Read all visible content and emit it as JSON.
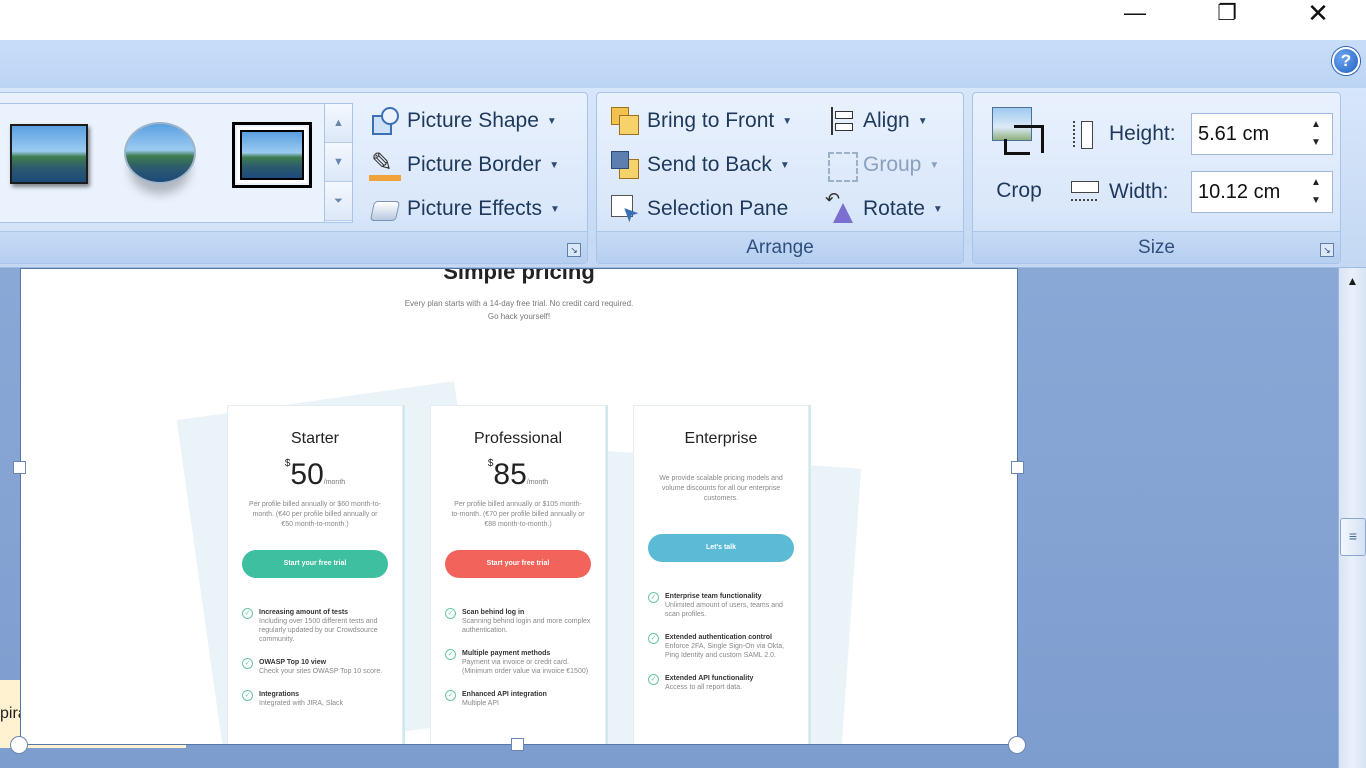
{
  "window": {
    "minimize": "—",
    "maximize": "❐",
    "close": "✕"
  },
  "help": "?",
  "picture_styles": {
    "commands": [
      {
        "label": "Picture Shape",
        "icon": "picture-shape-icon"
      },
      {
        "label": "Picture Border",
        "icon": "picture-border-icon"
      },
      {
        "label": "Picture Effects",
        "icon": "picture-effects-icon"
      }
    ]
  },
  "arrange": {
    "label": "Arrange",
    "bring_to_front": "Bring to Front",
    "send_to_back": "Send to Back",
    "selection_pane": "Selection Pane",
    "align": "Align",
    "group": "Group",
    "rotate": "Rotate"
  },
  "size": {
    "label": "Size",
    "crop": "Crop",
    "height_label": "Height:",
    "height_value": "5.61 cm",
    "width_label": "Width:",
    "width_value": "10.12 cm"
  },
  "note_text": "piration",
  "pricing": {
    "title": "Simple pricing",
    "subtitle_1": "Every plan starts with a 14-day free trial. No credit card required.",
    "subtitle_2": "Go hack yourself!",
    "plans": [
      {
        "name": "Starter",
        "currency": "$",
        "price": "50",
        "period": "/month",
        "desc": "Per profile billed annually or $60 month-to-month. (€40 per profile billed annually or €50 month-to-month.)",
        "button": "Start your free trial",
        "button_color": "#3dbfa0",
        "features": [
          {
            "title": "Increasing amount of tests",
            "desc": "Including over 1500 different tests and regularly updated by our Crowdsource community."
          },
          {
            "title": "OWASP Top 10 view",
            "desc": "Check your sites OWASP Top 10 score."
          },
          {
            "title": "Integrations",
            "desc": "Integrated with JIRA, Slack"
          }
        ]
      },
      {
        "name": "Professional",
        "currency": "$",
        "price": "85",
        "period": "/month",
        "desc": "Per profile billed annually or $105 month-to-month. (€70 per profile billed annually or €88 month-to-month.)",
        "button": "Start your free trial",
        "button_color": "#f2635b",
        "features": [
          {
            "title": "Scan behind log in",
            "desc": "Scanning behind login and more complex authentication."
          },
          {
            "title": "Multiple payment methods",
            "desc": "Payment via invoice or credit card. (Minimum order value via invoice €1500)"
          },
          {
            "title": "Enhanced API integration",
            "desc": "Multiple API"
          }
        ]
      },
      {
        "name": "Enterprise",
        "desc": "We provide scalable pricing models and volume discounts for all our enterprise customers.",
        "button": "Let's talk",
        "button_color": "#5bbad6",
        "features": [
          {
            "title": "Enterprise team functionality",
            "desc": "Unlimited amount of users, teams and scan profiles."
          },
          {
            "title": "Extended authentication control",
            "desc": "Enforce 2FA, Single Sign-On via Okta, Ping Identity and custom SAML 2.0."
          },
          {
            "title": "Extended API functionality",
            "desc": "Access to all report data."
          }
        ]
      }
    ]
  }
}
